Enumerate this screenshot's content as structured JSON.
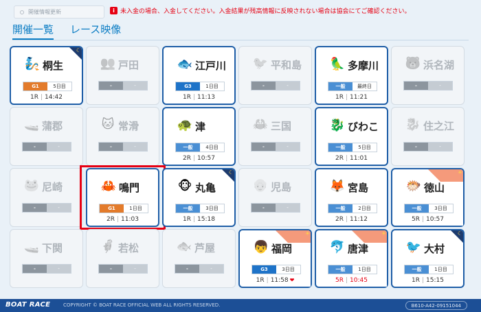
{
  "header": {
    "refresh_label": "開催情報更新",
    "notice": "未入金の場合、入金してください。入金結果が残高情報に反映されない場合は協会にてご確認ください。"
  },
  "tabs": [
    {
      "label": "開催一覧",
      "active": true
    },
    {
      "label": "レース映像",
      "active": false
    }
  ],
  "venues": [
    {
      "name": "桐生",
      "icon": "kiryu-mascot-icon",
      "emoji": "🧞",
      "active": true,
      "corner": "night",
      "grade": "G1",
      "day": "5日目",
      "race": "1R",
      "time": "14:42"
    },
    {
      "name": "戸田",
      "icon": "toda-mascot-icon",
      "emoji": "👥",
      "active": false,
      "grade": "-",
      "day": "-"
    },
    {
      "name": "江戸川",
      "icon": "edogawa-mascot-icon",
      "emoji": "🐟",
      "active": true,
      "corner": "",
      "grade": "G3",
      "day": "1日目",
      "race": "1R",
      "time": "11:13"
    },
    {
      "name": "平和島",
      "icon": "heiwajima-mascot-icon",
      "emoji": "🐦",
      "active": false,
      "grade": "-",
      "day": "-"
    },
    {
      "name": "多摩川",
      "icon": "tamagawa-mascot-icon",
      "emoji": "🦜",
      "active": true,
      "corner": "",
      "grade": "一般",
      "day": "最終日",
      "race": "1R",
      "time": "11:21"
    },
    {
      "name": "浜名湖",
      "icon": "hamanako-mascot-icon",
      "emoji": "🐻",
      "active": false,
      "grade": "-",
      "day": "-"
    },
    {
      "name": "蒲郡",
      "icon": "gamagori-mascot-icon",
      "emoji": "🚤",
      "active": false,
      "grade": "-",
      "day": "-"
    },
    {
      "name": "常滑",
      "icon": "tokoname-mascot-icon",
      "emoji": "🐱",
      "active": false,
      "grade": "-",
      "day": "-"
    },
    {
      "name": "津",
      "icon": "tsu-mascot-icon",
      "emoji": "🐢",
      "active": true,
      "corner": "",
      "grade": "一般",
      "day": "4日目",
      "race": "2R",
      "time": "10:57"
    },
    {
      "name": "三国",
      "icon": "mikuni-mascot-icon",
      "emoji": "🦀",
      "active": false,
      "grade": "-",
      "day": "-"
    },
    {
      "name": "びわこ",
      "icon": "biwako-mascot-icon",
      "emoji": "🐉",
      "active": true,
      "corner": "",
      "grade": "一般",
      "day": "5日目",
      "race": "2R",
      "time": "11:01"
    },
    {
      "name": "住之江",
      "icon": "suminoe-mascot-icon",
      "emoji": "🐉",
      "active": false,
      "grade": "-",
      "day": "-"
    },
    {
      "name": "尼崎",
      "icon": "amagasaki-mascot-icon",
      "emoji": "🐸",
      "active": false,
      "grade": "-",
      "day": "-"
    },
    {
      "name": "鳴門",
      "icon": "naruto-mascot-icon",
      "emoji": "🦀",
      "active": true,
      "corner": "",
      "grade": "G1",
      "day": "1日目",
      "race": "2R",
      "time": "11:03",
      "selected": true
    },
    {
      "name": "丸亀",
      "icon": "marugame-mascot-icon",
      "emoji": "🐵",
      "active": true,
      "corner": "night",
      "grade": "一般",
      "day": "3日目",
      "race": "1R",
      "time": "15:18"
    },
    {
      "name": "児島",
      "icon": "kojima-mascot-icon",
      "emoji": "👴",
      "active": false,
      "grade": "-",
      "day": "-"
    },
    {
      "name": "宮島",
      "icon": "miyajima-mascot-icon",
      "emoji": "🦊",
      "active": true,
      "corner": "",
      "grade": "一般",
      "day": "2日目",
      "race": "2R",
      "time": "11:12"
    },
    {
      "name": "徳山",
      "icon": "tokuyama-mascot-icon",
      "emoji": "🐡",
      "active": true,
      "corner": "day",
      "grade": "一般",
      "day": "3日目",
      "race": "5R",
      "time": "10:57"
    },
    {
      "name": "下関",
      "icon": "shimonoseki-mascot-icon",
      "emoji": "🚤",
      "active": false,
      "grade": "-",
      "day": "-"
    },
    {
      "name": "若松",
      "icon": "wakamatsu-mascot-icon",
      "emoji": "🦸",
      "active": false,
      "grade": "-",
      "day": "-"
    },
    {
      "name": "芦屋",
      "icon": "ashiya-mascot-icon",
      "emoji": "🐟",
      "active": false,
      "grade": "-",
      "day": "-"
    },
    {
      "name": "福岡",
      "icon": "fukuoka-mascot-icon",
      "emoji": "👦",
      "active": true,
      "corner": "day",
      "grade": "G3",
      "day": "3日目",
      "race": "1R",
      "time": "11:58",
      "heart": "❤"
    },
    {
      "name": "唐津",
      "icon": "karatsu-mascot-icon",
      "emoji": "🐬",
      "active": true,
      "corner": "day",
      "grade": "一般",
      "day": "1日目",
      "race": "5R",
      "time": "10:45",
      "warn": true
    },
    {
      "name": "大村",
      "icon": "omura-mascot-icon",
      "emoji": "🐦",
      "active": true,
      "corner": "night",
      "grade": "一般",
      "day": "1日目",
      "race": "1R",
      "time": "15:15"
    }
  ],
  "footer": {
    "logo": "BOAT RACE",
    "copyright": "COPYRIGHT © BOAT RACE OFFICIAL WEB ALL RIGHTS RESERVED.",
    "code": "B610-A42-09151044"
  },
  "colors": {
    "accent": "#1d5da6",
    "warning": "#e60012",
    "g1": "#e37b2b",
    "g3": "#1e73c8"
  }
}
